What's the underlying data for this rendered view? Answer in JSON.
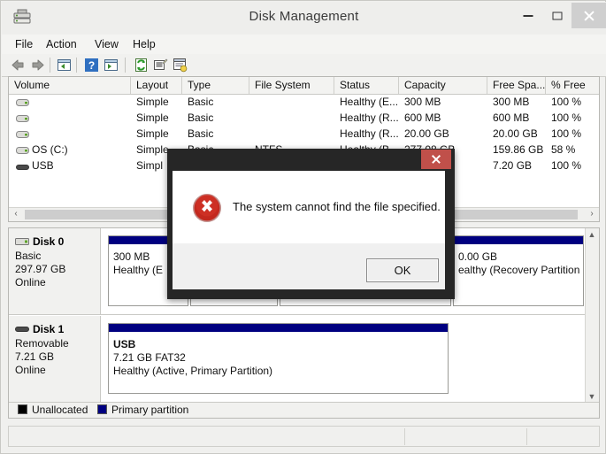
{
  "window": {
    "title": "Disk Management",
    "icon": "disk-management-icon",
    "controls": {
      "minimize": "–",
      "maximize": "□",
      "close": "×"
    }
  },
  "menu": {
    "items": [
      "File",
      "Action",
      "View",
      "Help"
    ]
  },
  "toolbar": {
    "icons": [
      "back-arrow-icon",
      "forward-arrow-icon",
      "up-one-level-icon",
      "help-icon",
      "show-hide-console-tree-icon",
      "refresh-icon",
      "properties-icon",
      "options-icon"
    ]
  },
  "volume_list": {
    "columns": [
      "Volume",
      "Layout",
      "Type",
      "File System",
      "Status",
      "Capacity",
      "Free Spa...",
      "% Free"
    ],
    "rows": [
      {
        "volume": "",
        "layout": "Simple",
        "type": "Basic",
        "filesystem": "",
        "status": "Healthy (E...",
        "capacity": "300 MB",
        "free": "300 MB",
        "percent": "100 %"
      },
      {
        "volume": "",
        "layout": "Simple",
        "type": "Basic",
        "filesystem": "",
        "status": "Healthy (R...",
        "capacity": "600 MB",
        "free": "600 MB",
        "percent": "100 %"
      },
      {
        "volume": "",
        "layout": "Simple",
        "type": "Basic",
        "filesystem": "",
        "status": "Healthy (R...",
        "capacity": "20.00 GB",
        "free": "20.00 GB",
        "percent": "100 %"
      },
      {
        "volume": "OS (C:)",
        "layout": "Simple",
        "type": "Basic",
        "filesystem": "NTFS",
        "status": "Healthy (B",
        "capacity": "277.08 GB",
        "free": "159.86 GB",
        "percent": "58 %"
      },
      {
        "volume": "USB",
        "layout": "Simpl",
        "type": "",
        "filesystem": "",
        "status": "",
        "capacity": "",
        "free": "7.20 GB",
        "percent": "100 %"
      }
    ],
    "scroll": {
      "left_arrow": "‹",
      "right_arrow": "›"
    }
  },
  "disks": [
    {
      "name": "Disk 0",
      "kind": "Basic",
      "size": "297.97 GB",
      "state": "Online",
      "partitions": [
        {
          "l1": "",
          "l2": "300 MB",
          "l3": "Healthy (E"
        },
        {
          "l1": "",
          "l2": "",
          "l3": ""
        },
        {
          "l1": "",
          "l2": "",
          "l3": ""
        },
        {
          "l1": "",
          "l2": "0.00 GB",
          "l3": "ealthy (Recovery Partition"
        }
      ]
    },
    {
      "name": "Disk 1",
      "kind": "Removable",
      "size": "7.21 GB",
      "state": "Online",
      "partitions": [
        {
          "l1": "USB",
          "l2": "7.21 GB FAT32",
          "l3": "Healthy (Active, Primary Partition)"
        }
      ]
    }
  ],
  "disk_scroll": {
    "up_arrow": "▲",
    "down_arrow": "▼"
  },
  "legend": {
    "items": [
      {
        "label": "Unallocated",
        "color": "#000000"
      },
      {
        "label": "Primary partition",
        "color": "#000080"
      }
    ]
  },
  "dialog": {
    "title": "",
    "message": "The system cannot find the file specified.",
    "ok_label": "OK",
    "icon": "error-icon",
    "close_label": "×",
    "accent": "#c0504a"
  },
  "status_bar": {
    "panes": [
      "",
      "",
      ""
    ]
  }
}
